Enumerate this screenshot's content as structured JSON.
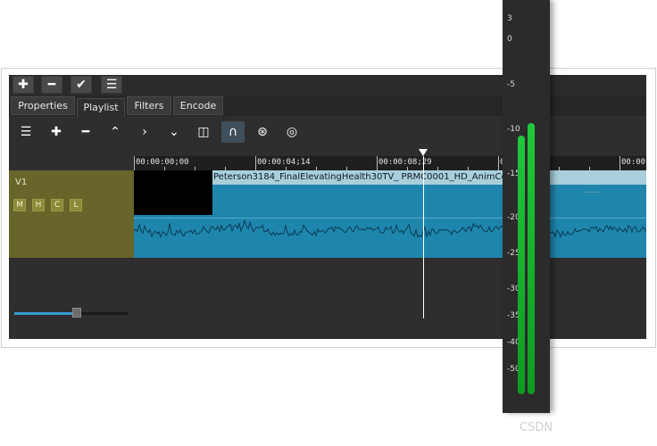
{
  "toolbar": {
    "buttons": [
      {
        "icon": "plus-icon",
        "glyph": "✚"
      },
      {
        "icon": "minus-icon",
        "glyph": "━"
      },
      {
        "icon": "check-icon",
        "glyph": "✔"
      },
      {
        "icon": "menu-icon",
        "glyph": "☰"
      }
    ]
  },
  "tabs": [
    {
      "label": "Properties",
      "active": false
    },
    {
      "label": "Playlist",
      "active": true
    },
    {
      "label": "Filters",
      "active": false
    },
    {
      "label": "Encode",
      "active": false
    }
  ],
  "timeline_toolbar": [
    {
      "name": "timeline-menu-icon",
      "glyph": "☰"
    },
    {
      "name": "append-icon",
      "glyph": "✚"
    },
    {
      "name": "remove-icon",
      "glyph": "━"
    },
    {
      "name": "lift-icon",
      "glyph": "⌃"
    },
    {
      "name": "overwrite-icon",
      "glyph": "›"
    },
    {
      "name": "split-icon",
      "glyph": "⌄"
    },
    {
      "name": "split-at-playhead-icon",
      "glyph": "◫"
    },
    {
      "name": "snap-icon",
      "glyph": "∩"
    },
    {
      "name": "scrub-icon",
      "glyph": "⊛"
    },
    {
      "name": "ripple-icon",
      "glyph": "◎"
    }
  ],
  "ruler": {
    "timecodes": [
      "00:00:00;00",
      "00:00:04;14",
      "00:00:08;29",
      "0",
      "00:00:"
    ]
  },
  "track": {
    "name": "V1",
    "buttons": [
      "M",
      "H",
      "C",
      "L"
    ],
    "clip_title": "Peterson3184_FinalElevatingHealth30TV_ PRMC0001_HD_AnimCod"
  },
  "zoom": {
    "value": 0.55
  },
  "audio_meter": {
    "scale": [
      "3",
      "0",
      "-5",
      "-10",
      "-15",
      "-20",
      "-25",
      "-30",
      "-35",
      "-40",
      "-50"
    ],
    "left_level_db": -11,
    "right_level_db": -9
  },
  "extra_text": "......",
  "watermark": "CSDN",
  "colors": {
    "track_head": "#67652a",
    "clip": "#1e86ad",
    "meter_green": "#22c73a"
  }
}
